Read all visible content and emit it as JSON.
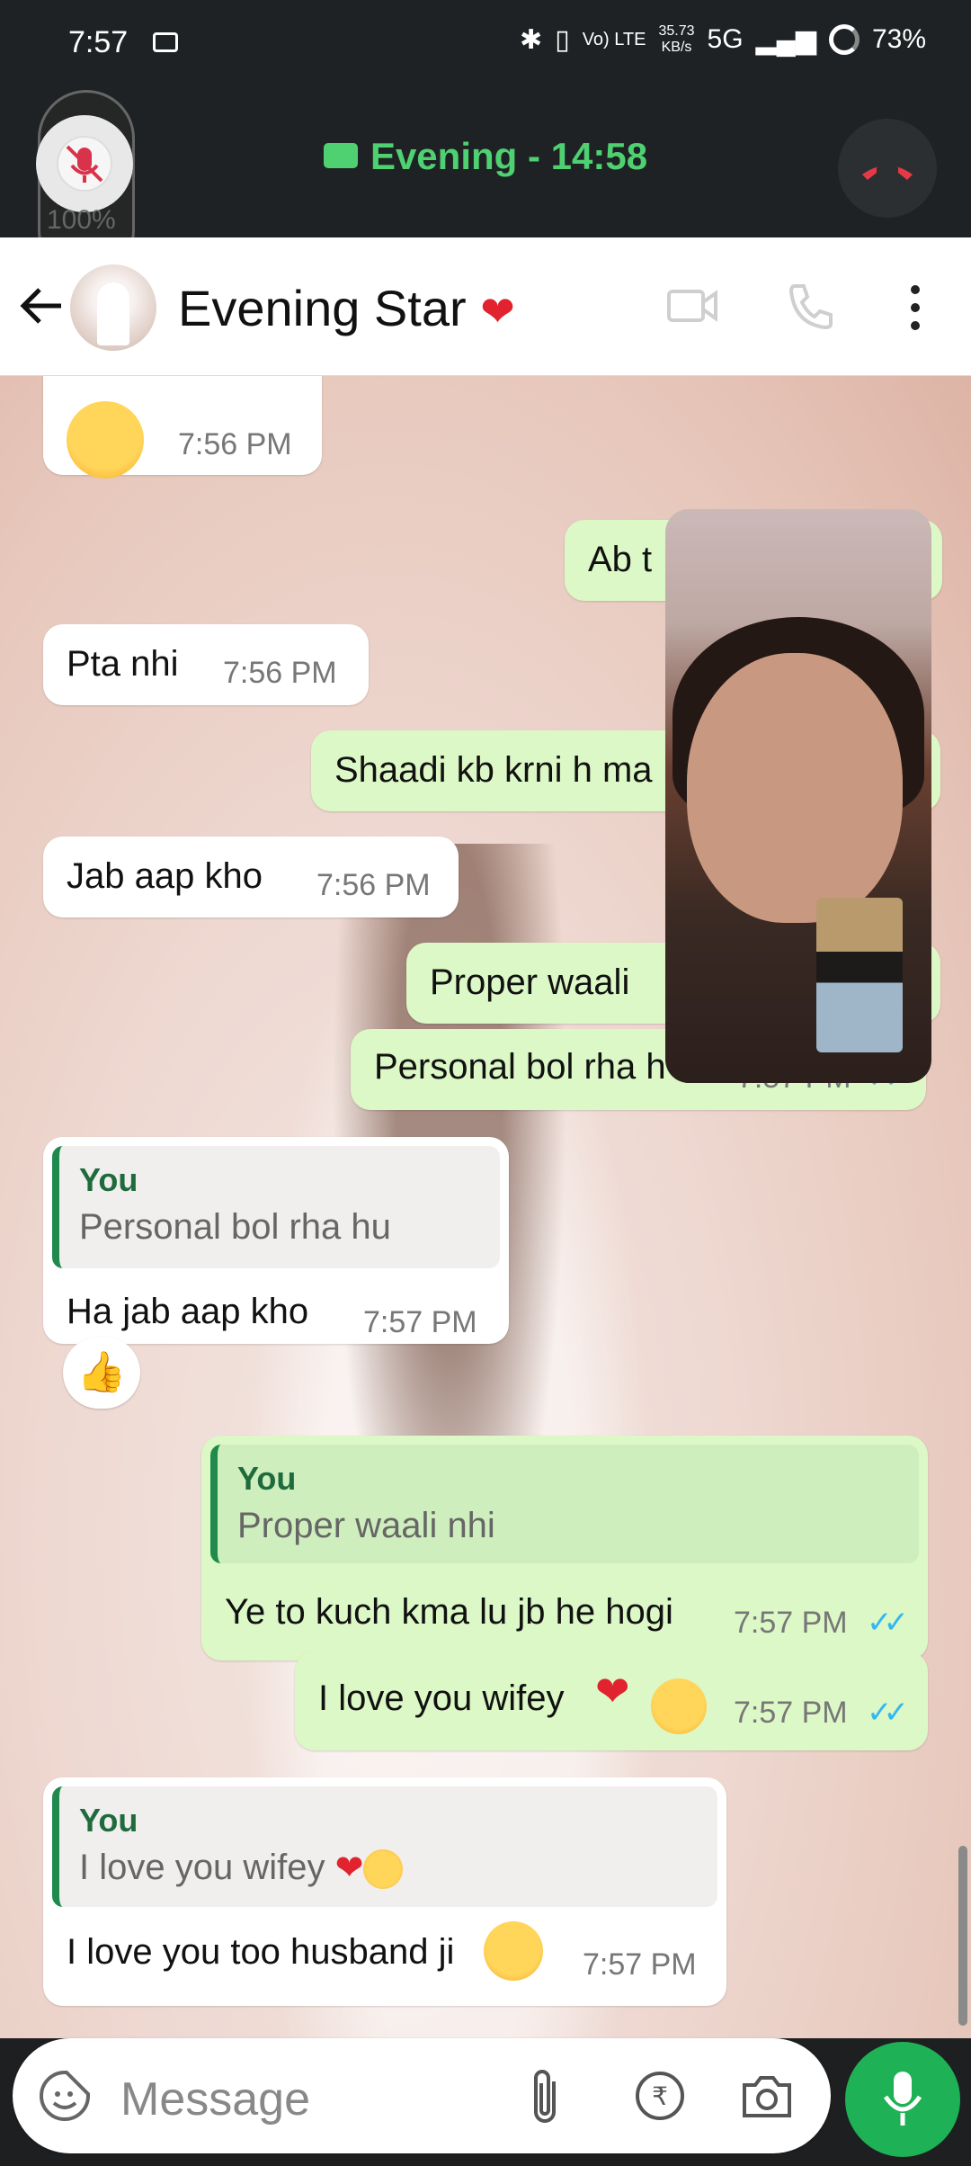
{
  "status": {
    "time": "7:57",
    "speed_top": "35.73",
    "speed_bottom": "KB/s",
    "network": "5G",
    "battery": "73%",
    "volte": "Vo) LTE"
  },
  "call": {
    "label": "Evening - 14:58",
    "mute_percent": "100%"
  },
  "header": {
    "name": "Evening Star",
    "emoji_name": "heart"
  },
  "messages": {
    "m1": {
      "time": "7:56 PM"
    },
    "m2": {
      "text": "Ab t"
    },
    "m3": {
      "text": "Pta nhi",
      "time": "7:56 PM"
    },
    "m4": {
      "text": "Shaadi kb krni h ma"
    },
    "m5": {
      "text": "Jab aap kho",
      "time": "7:56 PM"
    },
    "m6": {
      "text": "Proper waali"
    },
    "m7": {
      "text": "Personal bol rha h",
      "time": "7:57 PM"
    },
    "m8": {
      "quote_who": "You",
      "quote_text": "Personal bol rha hu",
      "text": "Ha jab aap kho",
      "time": "7:57 PM"
    },
    "m9": {
      "quote_who": "You",
      "quote_text": "Proper waali nhi",
      "text": "Ye to kuch kma lu jb he hogi",
      "time": "7:57 PM"
    },
    "m10": {
      "text": "I love you wifey",
      "time": "7:57 PM"
    },
    "m11": {
      "quote_who": "You",
      "quote_text": "I love you wifey",
      "text": "I love you too husband ji",
      "time": "7:57 PM"
    }
  },
  "input": {
    "placeholder": "Message"
  }
}
